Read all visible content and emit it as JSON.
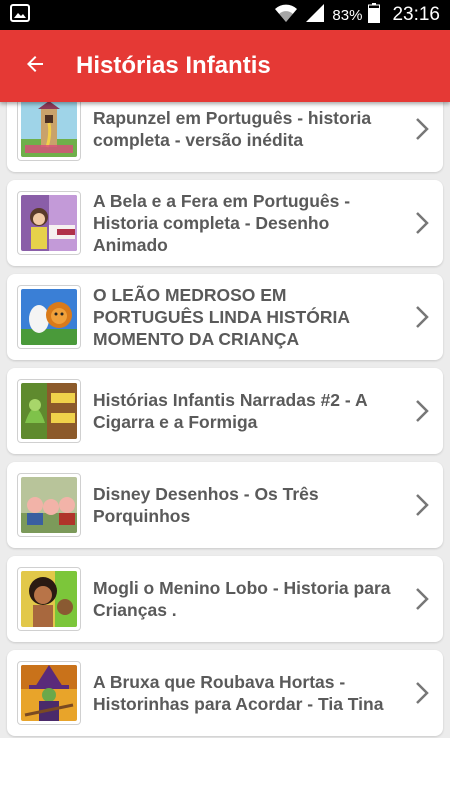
{
  "status_bar": {
    "battery_percent": "83%",
    "time": "23:16",
    "icons": [
      "image-icon",
      "wifi-icon",
      "signal-icon",
      "battery-icon"
    ]
  },
  "app_bar": {
    "title": "Histórias Infantis",
    "back_icon": "arrow-left-icon",
    "color": "#e53935"
  },
  "videos": [
    {
      "title": "Rapunzel em Português - historia completa - versão inédita",
      "thumbnail": "rapunzel-tower-thumbnail"
    },
    {
      "title": "A Bela e a Fera  em Português - Historia completa - Desenho Animado",
      "thumbnail": "beauty-beast-thumbnail"
    },
    {
      "title": "O LEÃO MEDROSO EM PORTUGUÊS LINDA HISTÓRIA   MOMENTO DA CRIANÇA",
      "thumbnail": "lion-unicorn-thumbnail"
    },
    {
      "title": "Histórias Infantis Narradas #2  - A Cigarra e a Formiga",
      "thumbnail": "cicada-ant-thumbnail"
    },
    {
      "title": "Disney Desenhos - Os Três Porquinhos",
      "thumbnail": "three-pigs-thumbnail"
    },
    {
      "title": "Mogli o Menino Lobo -   Historia para Crianças .",
      "thumbnail": "mowgli-thumbnail"
    },
    {
      "title": "A Bruxa que Roubava Hortas - Historinhas para Acordar - Tia Tina",
      "thumbnail": "witch-thumbnail"
    }
  ]
}
